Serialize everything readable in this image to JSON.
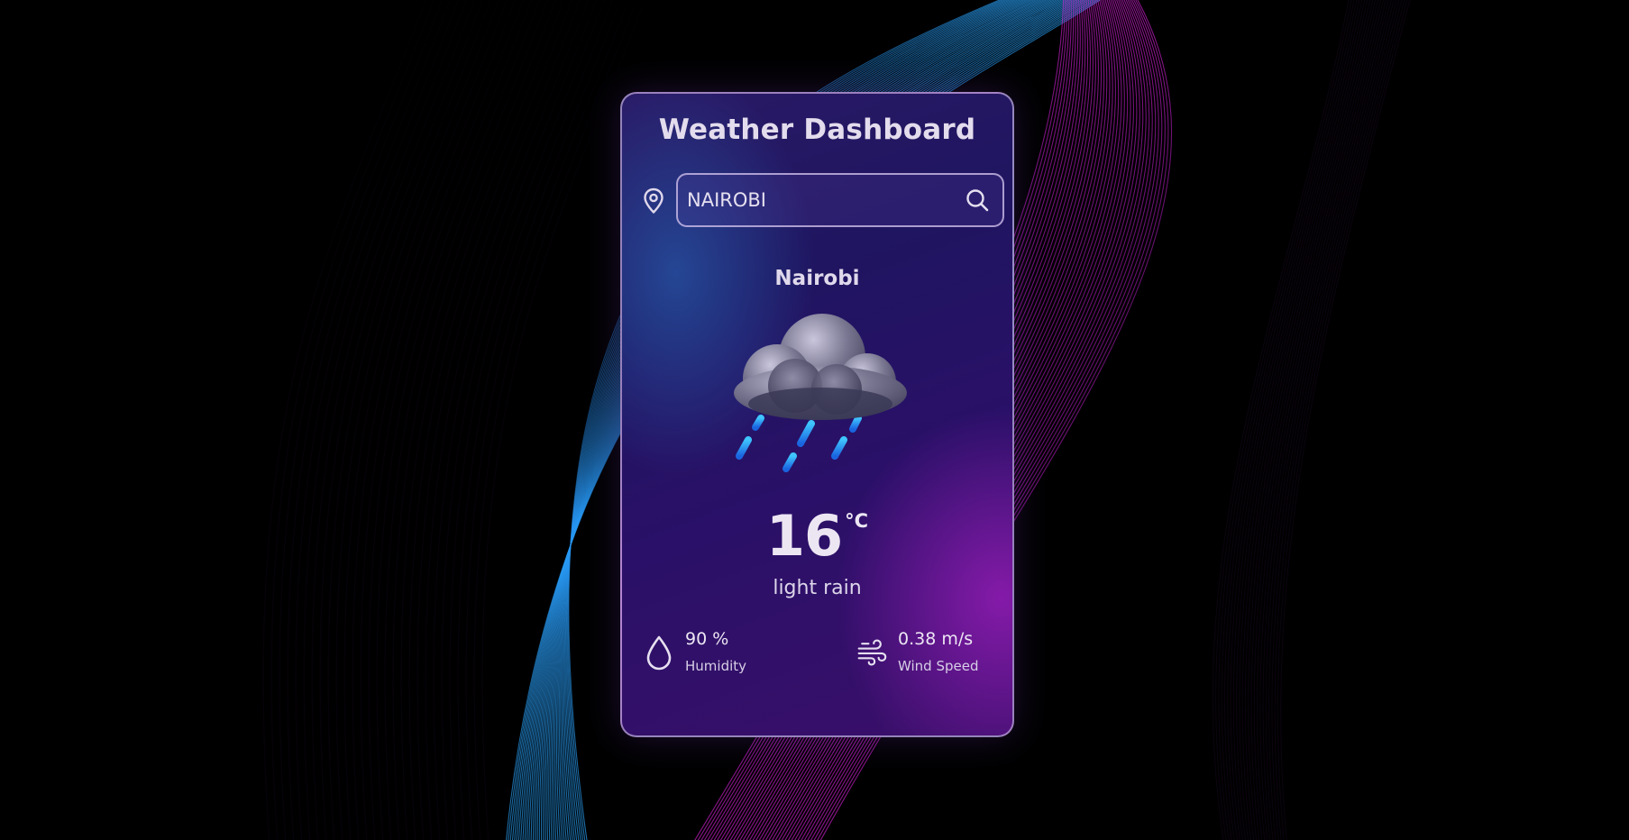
{
  "app": {
    "title": "Weather Dashboard"
  },
  "search": {
    "value": "NAIROBI",
    "placeholder": ""
  },
  "icons": {
    "location": "location-pin-icon",
    "search": "search-icon",
    "weather": "rain-cloud-icon",
    "humidity": "water-drop-icon",
    "wind": "wind-icon"
  },
  "weather": {
    "city": "Nairobi",
    "temperature": "16",
    "unit": "°C",
    "description": "light rain"
  },
  "stats": {
    "humidity": {
      "value": "90 %",
      "label": "Humidity"
    },
    "wind": {
      "value": "0.38 m/s",
      "label": "Wind Speed"
    }
  },
  "colors": {
    "background": "#000000",
    "accent_blue": "#2aa8ff",
    "accent_magenta": "#d21ee6",
    "text": "#e3dced"
  }
}
